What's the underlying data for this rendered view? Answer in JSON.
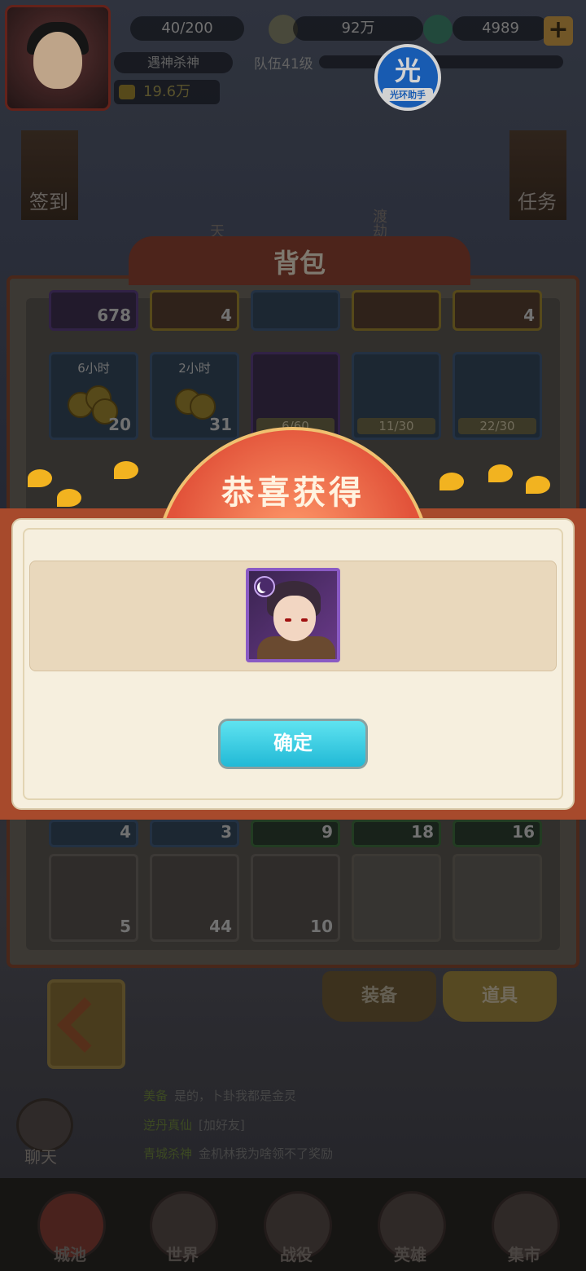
{
  "hud": {
    "stamina": "40/200",
    "coins": "92万",
    "gems": "4989",
    "player_title": "遇神杀神",
    "team_level": "队伍41级",
    "power": "19.6万",
    "plus": "+"
  },
  "overlay_badge": {
    "big": "光",
    "small": "光环助手"
  },
  "side_menu": {
    "sign_in": "签到",
    "tasks": "任务",
    "tian": "天",
    "duojie": "渡劫"
  },
  "bag": {
    "title": "背包",
    "row1_counts": [
      "678",
      "4",
      "",
      "",
      "4"
    ],
    "row2": [
      {
        "top": "6小时",
        "count": "20"
      },
      {
        "top": "2小时",
        "count": "31"
      },
      {
        "progress": "6/60"
      },
      {
        "progress": "11/30"
      },
      {
        "progress": "22/30"
      }
    ],
    "row_hidden_counts": [
      "4",
      "3",
      "9",
      "18",
      "16"
    ],
    "row_last_counts": [
      "5",
      "44",
      "10"
    ],
    "tabs": [
      "装备",
      "道具"
    ]
  },
  "chat": {
    "label": "聊天",
    "lines": [
      {
        "name": "美备",
        "text": "是的，卜卦我都是金灵"
      },
      {
        "name": "逆丹真仙",
        "text": "[加好友]"
      },
      {
        "name": "青城杀神",
        "text": "金机林我为啥领不了奖励"
      }
    ]
  },
  "bottom_nav": [
    "城池",
    "世界",
    "战役",
    "英雄",
    "集市"
  ],
  "dialog": {
    "title": "恭喜获得",
    "confirm": "确定"
  }
}
